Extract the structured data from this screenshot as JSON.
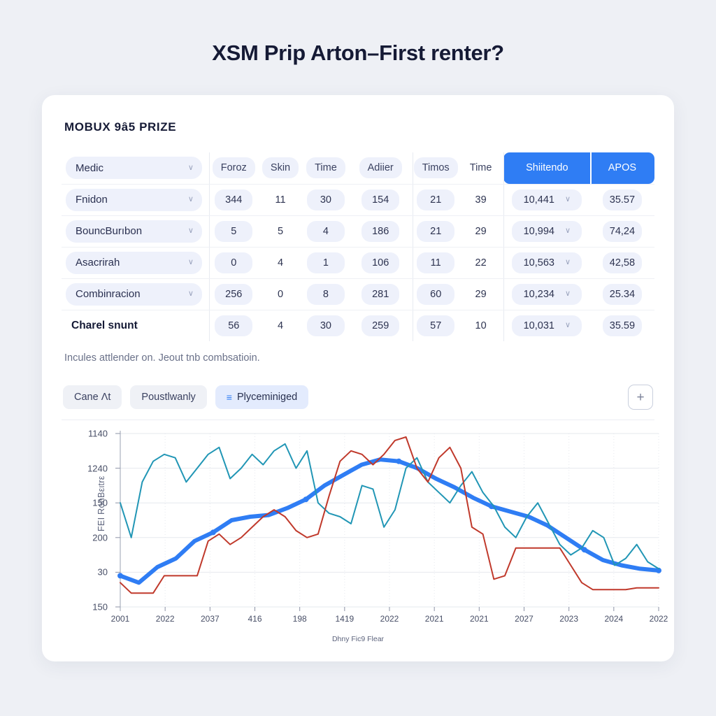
{
  "page": {
    "title": "XSM Prip Arton–First renter?",
    "background_color": "#eef0f5",
    "accent_color": "#2f7df4"
  },
  "card": {
    "section_title": "MOBUX 9ȃ5 PRIZE",
    "caption": "Incules attlender on. Jeout tnb combsatioin."
  },
  "table": {
    "headers": [
      {
        "label": "Medic",
        "type": "dropdown"
      },
      {
        "label": "Foroz",
        "type": "pill"
      },
      {
        "label": "Skin",
        "type": "pill"
      },
      {
        "label": "Time",
        "type": "pill"
      },
      {
        "label": "Adiier",
        "type": "pill"
      },
      {
        "label": "Timos",
        "type": "pill"
      },
      {
        "label": "Time",
        "type": "plain"
      },
      {
        "label": "Shiitendo",
        "type": "highlight"
      },
      {
        "label": "APOS",
        "type": "highlight"
      }
    ],
    "rows": [
      {
        "name": "Fnidon",
        "values": [
          "344",
          "11",
          "30",
          "154",
          "21",
          "39",
          "10,441",
          "35.57"
        ],
        "bold": false
      },
      {
        "name": "BouncBurıbon",
        "values": [
          "5",
          "5",
          "4",
          "186",
          "21",
          "29",
          "10,994",
          "74,24"
        ],
        "bold": false
      },
      {
        "name": "Asacrirah",
        "values": [
          "0",
          "4",
          "1",
          "106",
          "11",
          "22",
          "10,563",
          "42,58"
        ],
        "bold": false
      },
      {
        "name": "Combinracion",
        "values": [
          "256",
          "0",
          "8",
          "281",
          "60",
          "29",
          "10,234",
          "25.34"
        ],
        "bold": false
      },
      {
        "name": "Charel snunt",
        "values": [
          "56",
          "4",
          "30",
          "259",
          "57",
          "10",
          "10,031",
          "35.59"
        ],
        "bold": true
      }
    ]
  },
  "chips": [
    {
      "label": "Cane Λt",
      "active": false,
      "icon": ""
    },
    {
      "label": "Poustlwanly",
      "active": false,
      "icon": ""
    },
    {
      "label": "Plyceminiged",
      "active": true,
      "icon": "≡"
    }
  ],
  "add_button": {
    "label": "+"
  },
  "chart_data": {
    "type": "line",
    "title": "",
    "xlabel": "Dhny Fic9 Flear",
    "ylabel": "FEI RonBειtrε",
    "grid": true,
    "legend_position": "none",
    "ytick_labels": [
      "1140",
      "1240",
      "150",
      "200",
      "30",
      "150"
    ],
    "xtick_labels": [
      "2001",
      "2022",
      "2037",
      "416",
      "198",
      "1419",
      "2022",
      "2021",
      "2021",
      "2027",
      "2023",
      "2024",
      "2022"
    ],
    "series": [
      {
        "name": "trend-thick-blue",
        "color": "#2f7df4",
        "width": 6,
        "markers": true,
        "values": [
          18,
          14,
          23,
          28,
          38,
          43,
          50,
          52,
          53,
          57,
          62,
          70,
          76,
          82,
          85,
          84,
          80,
          74,
          69,
          63,
          58,
          55,
          52,
          47,
          40,
          33,
          27,
          24,
          22,
          21
        ]
      },
      {
        "name": "volatile-teal",
        "color": "#2196b5",
        "width": 2,
        "markers": false,
        "values": [
          60,
          40,
          72,
          84,
          88,
          86,
          72,
          80,
          88,
          92,
          74,
          80,
          88,
          82,
          90,
          94,
          80,
          90,
          60,
          54,
          52,
          48,
          70,
          68,
          46,
          56,
          80,
          86,
          72,
          66,
          60,
          70,
          78,
          66,
          58,
          46,
          40,
          52,
          60,
          48,
          36,
          30,
          34,
          44,
          40,
          24,
          28,
          36,
          26,
          22
        ]
      },
      {
        "name": "volatile-red",
        "color": "#c0392b",
        "width": 2,
        "markers": false,
        "values": [
          14,
          8,
          8,
          8,
          18,
          18,
          18,
          18,
          38,
          42,
          36,
          40,
          46,
          52,
          56,
          52,
          44,
          40,
          42,
          64,
          84,
          90,
          88,
          82,
          88,
          96,
          98,
          80,
          72,
          86,
          92,
          80,
          46,
          42,
          16,
          18,
          34,
          34,
          34,
          34,
          34,
          24,
          14,
          10,
          10,
          10,
          10,
          11,
          11,
          11
        ]
      }
    ]
  }
}
